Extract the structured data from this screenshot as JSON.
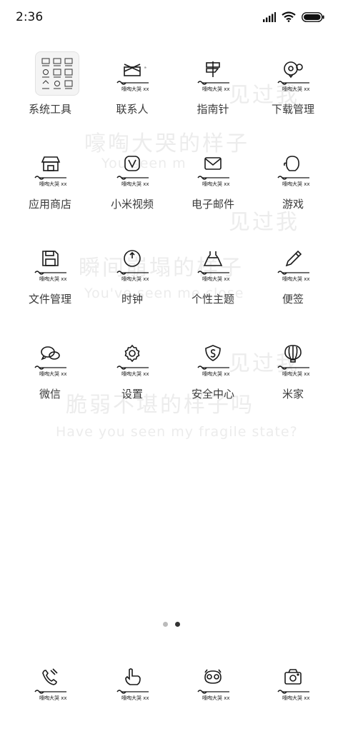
{
  "status_bar": {
    "time": "2:36"
  },
  "apps": [
    {
      "id": "tools",
      "label": "系统工具",
      "icon": "folder-icon"
    },
    {
      "id": "contacts",
      "label": "联系人",
      "icon": "contacts-icon"
    },
    {
      "id": "compass",
      "label": "指南针",
      "icon": "signpost-icon"
    },
    {
      "id": "downloads",
      "label": "下载管理",
      "icon": "download-icon"
    },
    {
      "id": "store",
      "label": "应用商店",
      "icon": "store-icon"
    },
    {
      "id": "video",
      "label": "小米视频",
      "icon": "video-icon"
    },
    {
      "id": "email",
      "label": "电子邮件",
      "icon": "mail-icon"
    },
    {
      "id": "games",
      "label": "游戏",
      "icon": "glove-icon"
    },
    {
      "id": "files",
      "label": "文件管理",
      "icon": "floppy-icon"
    },
    {
      "id": "clock",
      "label": "时钟",
      "icon": "clock-icon"
    },
    {
      "id": "themes",
      "label": "个性主题",
      "icon": "dress-icon"
    },
    {
      "id": "notes",
      "label": "便签",
      "icon": "pencil-icon"
    },
    {
      "id": "wechat",
      "label": "微信",
      "icon": "chat-icon"
    },
    {
      "id": "settings",
      "label": "设置",
      "icon": "gear-icon"
    },
    {
      "id": "security",
      "label": "安全中心",
      "icon": "shield-icon"
    },
    {
      "id": "mijia",
      "label": "米家",
      "icon": "balloon-icon"
    }
  ],
  "dock": [
    {
      "id": "phone",
      "icon": "phone-icon"
    },
    {
      "id": "browser",
      "icon": "hand-icon"
    },
    {
      "id": "messages",
      "icon": "face-icon"
    },
    {
      "id": "camera",
      "icon": "camera-icon"
    }
  ],
  "theme_caption": "嚎啕大哭 xx",
  "wallpaper": {
    "lines": [
      "见过我",
      "嚎啕大哭的样子",
      "You    seen m",
      "见过我",
      "瞬间崩塌的样子",
      "You've seen me  close",
      "见过我",
      "脆弱不堪的样子吗",
      "Have you seen my fragile state?"
    ]
  },
  "pager": {
    "pages": 2,
    "current": 2
  },
  "colors": {
    "background": "#ffffff",
    "label": "#3a3a3a",
    "icon": "#1a1a1a",
    "wallpaper_text": "#ececec",
    "dot_active": "#333333",
    "dot_inactive": "#bbbbbb"
  }
}
